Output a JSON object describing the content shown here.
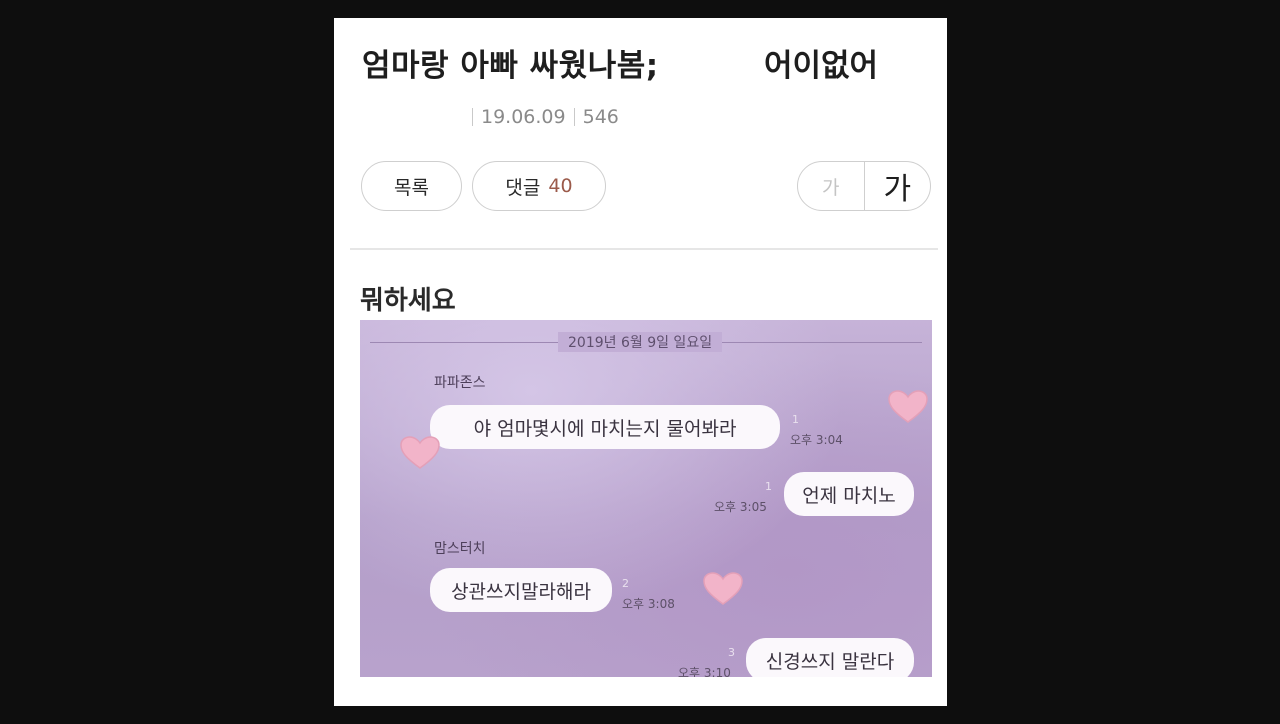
{
  "post": {
    "title": "엄마랑 아빠 싸웠나봄;",
    "title_suffix": "어이없어",
    "date": "19.06.09",
    "views": "546",
    "list_button": "목록",
    "comment_label": "댓글",
    "comment_count": "40",
    "font_small": "가",
    "font_large": "가",
    "body_text": "뭐하세요"
  },
  "chat": {
    "date": "2019년 6월 9일 일요일",
    "messages": [
      {
        "sender": "파파존스",
        "text": "야 엄마몇시에 마치는지 물어봐라",
        "unread": "1",
        "time": "오후 3:04"
      },
      {
        "text": "언제 마치노",
        "unread": "1",
        "time": "오후 3:05"
      },
      {
        "sender": "맘스터치",
        "text": "상관쓰지말라해라",
        "unread": "2",
        "time": "오후 3:08"
      },
      {
        "text": "신경쓰지 말란다",
        "unread": "3",
        "time": "오후 3:10"
      }
    ]
  },
  "colors": {
    "background": "#0e0e0e",
    "card": "#ffffff",
    "chat_background": "#b9a3cc",
    "bubble": "#fbf8fc",
    "heart": "#f2b4c9",
    "comment_count": "#9b5a4a"
  }
}
